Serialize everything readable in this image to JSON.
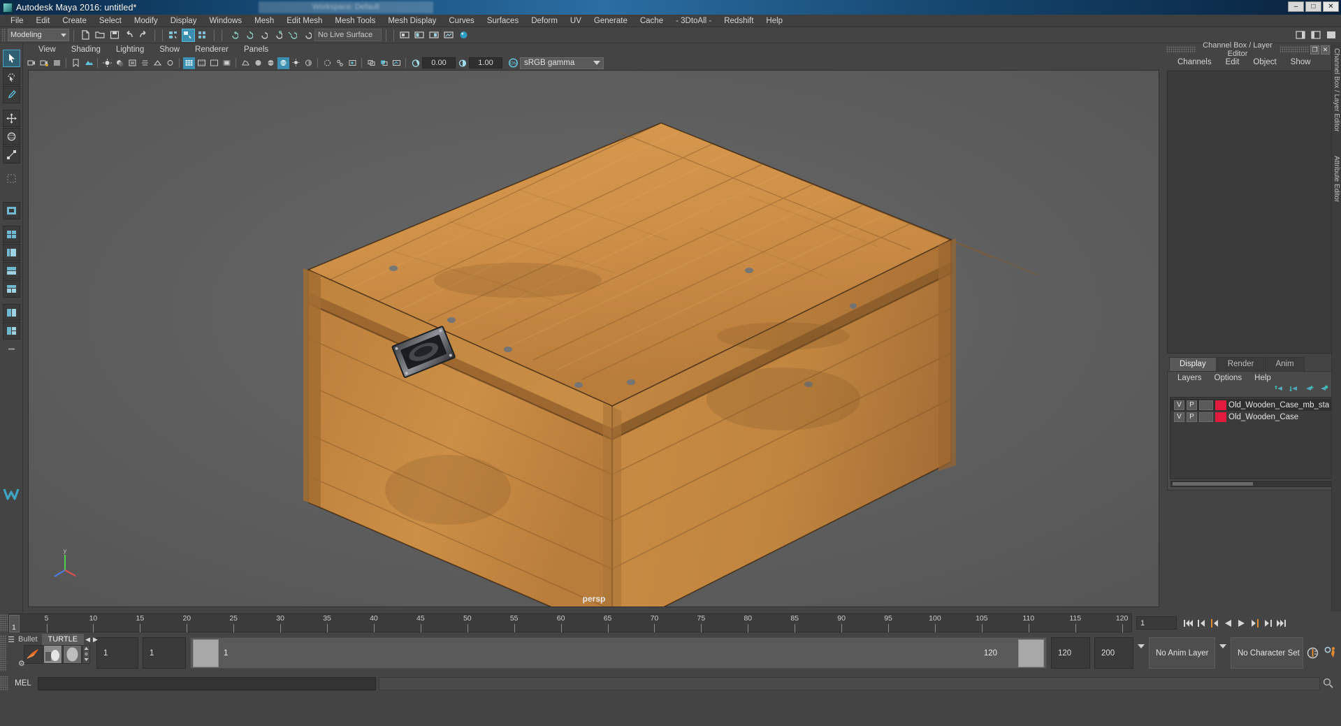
{
  "window": {
    "title": "Autodesk Maya 2016: untitled*",
    "ghost_tab": "Workspace: Default",
    "minimize": "–",
    "maximize": "□",
    "close": "✕",
    "app_icon": "maya-icon"
  },
  "main_menu": [
    "File",
    "Edit",
    "Create",
    "Select",
    "Modify",
    "Display",
    "Windows",
    "Mesh",
    "Edit Mesh",
    "Mesh Tools",
    "Mesh Display",
    "Curves",
    "Surfaces",
    "Deform",
    "UV",
    "Generate",
    "Cache",
    "- 3DtoAll -",
    "Redshift",
    "Help"
  ],
  "status_bar": {
    "mode": "Modeling",
    "live_surface": "No Live Surface",
    "icons": [
      "new-scene-icon",
      "open-scene-icon",
      "save-scene-icon",
      "undo-icon",
      "redo-icon",
      "select-by-hierarchy-icon",
      "select-by-object-icon",
      "select-by-component-icon",
      "snap-to-grid-icon",
      "snap-to-curve-icon",
      "snap-to-point-icon",
      "snap-to-projected-center-icon",
      "snap-to-view-plane-icon",
      "make-live-icon",
      "show-render-view-icon",
      "render-icon",
      "ipr-render-icon",
      "render-settings-icon",
      "sphere-icon"
    ],
    "right_icons": [
      "sidebar-toggle-icon",
      "attribute-editor-toggle-icon",
      "channel-box-toggle-icon"
    ]
  },
  "toolbox": {
    "tools": [
      {
        "name": "select-tool",
        "active": true
      },
      {
        "name": "lasso-select-tool",
        "active": false
      },
      {
        "name": "paint-select-tool",
        "active": false
      },
      {
        "name": "move-tool",
        "active": false
      },
      {
        "name": "rotate-tool",
        "active": false
      },
      {
        "name": "scale-tool",
        "active": false
      },
      {
        "name": "last-tool-used",
        "active": false
      },
      {
        "name": "single-perspective-layout",
        "active": false
      },
      {
        "name": "four-view-layout",
        "active": false
      },
      {
        "name": "persp-outliner-layout",
        "active": false
      },
      {
        "name": "persp-graph-layout",
        "active": false
      },
      {
        "name": "persp-hypershade-layout",
        "active": false
      },
      {
        "name": "two-pane-layout",
        "active": false
      },
      {
        "name": "three-pane-layout",
        "active": false
      },
      {
        "name": "more-layouts",
        "active": false
      }
    ],
    "logo": "maya-logo-icon"
  },
  "viewport": {
    "menu": [
      "View",
      "Shading",
      "Lighting",
      "Show",
      "Renderer",
      "Panels"
    ],
    "exposure_value": "0.00",
    "gamma_value": "1.00",
    "color_management": "sRGB gamma",
    "camera_label": "persp",
    "toolbar_icons": [
      "select-camera-icon",
      "lock-camera-icon",
      "camera-attributes-icon",
      "bookmark-icon",
      "image-plane-icon",
      "two-sided-lighting-icon",
      "shadows-icon",
      "screen-space-ao-icon",
      "motion-blur-icon",
      "multisample-aa-icon",
      "depth-of-field-icon",
      "grid-toggle-icon",
      "film-gate-icon",
      "resolution-gate-icon",
      "gate-mask-icon",
      "wireframe-icon",
      "smooth-shade-icon",
      "shaded-wireframe-icon",
      "textured-icon",
      "lights-icon",
      "shadow-map-icon",
      "xray-icon",
      "xray-joints-icon",
      "xray-active-components-icon",
      "isolate-select-icon",
      "substitute-geometry-icon",
      "snapshot-icon",
      "exposure-icon",
      "gamma-icon",
      "color-management-toggle-icon"
    ]
  },
  "right_dock": {
    "panel_title": "Channel Box / Layer Editor",
    "restore_btn": "❐",
    "close_btn": "✕",
    "menu": [
      "Channels",
      "Edit",
      "Object",
      "Show"
    ],
    "vertical_tabs": [
      "Channel Box / Layer Editor",
      "Attribute Editor"
    ],
    "layer_tabs": [
      {
        "label": "Display",
        "active": true
      },
      {
        "label": "Render",
        "active": false
      },
      {
        "label": "Anim",
        "active": false
      }
    ],
    "layer_menu": [
      "Layers",
      "Options",
      "Help"
    ],
    "layer_icons": [
      "move-layer-up-icon",
      "move-layer-down-icon",
      "create-new-layer-icon",
      "create-layer-from-selected-icon"
    ],
    "layers": [
      {
        "visibility": "V",
        "playback": "P",
        "state": "",
        "color": "#e31c3d",
        "name": "Old_Wooden_Case_mb_sta",
        "selected": true
      },
      {
        "visibility": "V",
        "playback": "P",
        "state": "",
        "color": "#e31c3d",
        "name": "Old_Wooden_Case",
        "selected": false
      }
    ]
  },
  "time_slider": {
    "ticks": [
      5,
      10,
      15,
      20,
      25,
      30,
      35,
      40,
      45,
      50,
      55,
      60,
      65,
      70,
      75,
      80,
      85,
      90,
      95,
      100,
      105,
      110,
      115,
      120
    ],
    "current_frame": "1",
    "end_label": "120",
    "current_time_field": "1",
    "playback_buttons": [
      "go-to-start-icon",
      "step-back-frame-icon",
      "step-back-key-icon",
      "play-backwards-icon",
      "play-forwards-icon",
      "step-forward-key-icon",
      "step-forward-frame-icon",
      "go-to-end-icon"
    ]
  },
  "range_slider": {
    "shelf_tabs": [
      "Bullet",
      "TURTLE"
    ],
    "shelf_active_tab": "TURTLE",
    "shelf_nav_prev": "◀",
    "shelf_nav_next": "▶",
    "shelf_icons": [
      "turtle-render-icon",
      "turtle-bake-icon",
      "turtle-texture-icon"
    ],
    "anim_start": "1",
    "playback_start": "1",
    "bar_start_label": "1",
    "bar_end_label": "120",
    "playback_end": "120",
    "anim_end": "200",
    "anim_layer": "No Anim Layer",
    "character_set": "No Character Set",
    "auto_key_icon": "auto-keyframe-icon",
    "anim_prefs_icon": "animation-preferences-icon"
  },
  "command_line": {
    "label": "MEL",
    "input_value": "",
    "output_value": "",
    "help_icon": "help-icon"
  },
  "colors": {
    "accent_blue": "#3c8fb0",
    "layer_red": "#e31c3d",
    "panel_bg": "#444444",
    "viewport_bg": "#5d5d5d",
    "title_blue": "#1b5f94",
    "orange": "#e08a33"
  },
  "scene": {
    "object": "Old Wooden Case",
    "description": "wooden crate 3D model shaded with wood texture"
  }
}
